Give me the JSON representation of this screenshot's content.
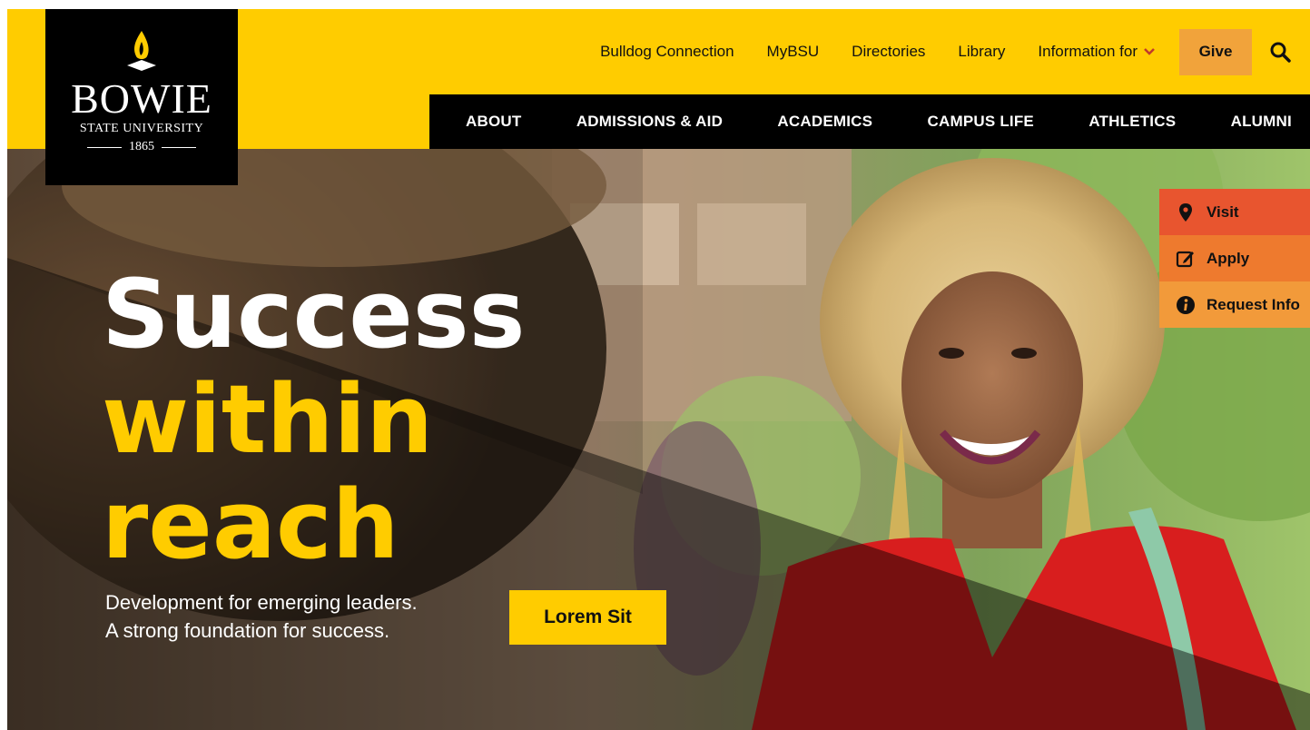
{
  "logo": {
    "name": "BOWIE",
    "subtitle": "STATE UNIVERSITY",
    "year": "1865"
  },
  "utility_nav": {
    "items": [
      "Bulldog Connection",
      "MyBSU",
      "Directories",
      "Library"
    ],
    "info_for": "Information for",
    "give": "Give"
  },
  "main_nav": {
    "items": [
      "ABOUT",
      "ADMISSIONS & AID",
      "ACADEMICS",
      "CAMPUS LIFE",
      "ATHLETICS",
      "ALUMNI"
    ]
  },
  "hero": {
    "line1": "Success",
    "line2": "within",
    "line3": "reach",
    "sub1": "Development for emerging leaders.",
    "sub2": "A strong foundation for success.",
    "cta": "Lorem Sit"
  },
  "quick_links": {
    "visit": "Visit",
    "apply": "Apply",
    "request_info": "Request Info"
  },
  "colors": {
    "brand_yellow": "#FFCC00",
    "black": "#000000",
    "give_orange": "#F1A33B",
    "visit_red": "#E8552F",
    "apply_orange": "#EE7A2E",
    "info_orange": "#F29A3A"
  }
}
